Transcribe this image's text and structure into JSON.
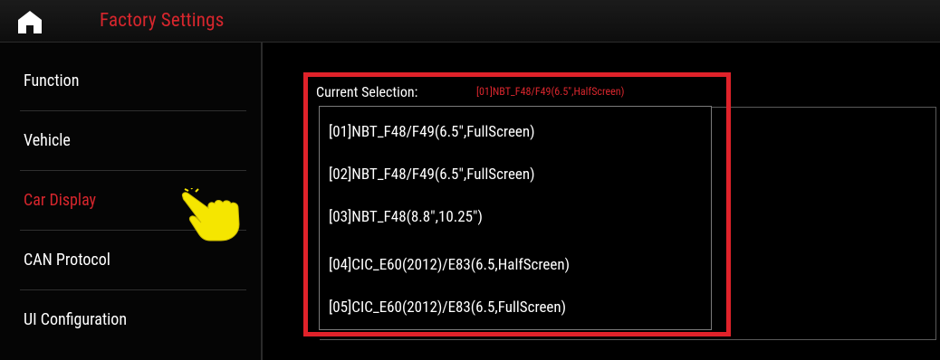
{
  "header": {
    "title": "Factory Settings",
    "home_icon": "home-icon"
  },
  "sidebar": {
    "items": [
      {
        "label": "Function",
        "active": false
      },
      {
        "label": "Vehicle",
        "active": false
      },
      {
        "label": "Car Display",
        "active": true
      },
      {
        "label": "CAN Protocol",
        "active": false
      },
      {
        "label": "UI Configuration",
        "active": false
      }
    ]
  },
  "main": {
    "current_selection_label": "Current Selection:",
    "current_selection_value": "[01]NBT_F48/F49(6.5\",HalfScreen)",
    "options": [
      "[01]NBT_F48/F49(6.5\",FullScreen)",
      "[02]NBT_F48/F49(6.5\",FullScreen)",
      "[03]NBT_F48(8.8\",10.25\")",
      "[04]CIC_E60(2012)/E83(6.5,HalfScreen)",
      "[05]CIC_E60(2012)/E83(6.5,FullScreen)"
    ]
  },
  "colors": {
    "accent_red": "#d8262d",
    "highlight_red": "#e0222a",
    "background": "#000000",
    "pointer_yellow": "#f5e600"
  },
  "annotations": {
    "pointer_icon": "pointing-hand-icon"
  }
}
